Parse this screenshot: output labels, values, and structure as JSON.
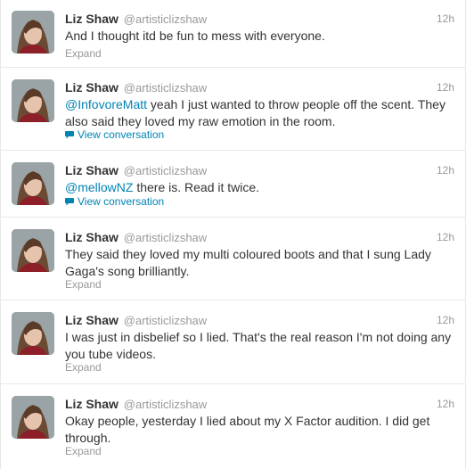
{
  "tweets": [
    {
      "fullname": "Liz Shaw",
      "username": "@artisticlizshaw",
      "time": "12h",
      "mention": "",
      "line1": "And I thought itd be fun to mess with everyone.",
      "line2": "",
      "action": "Expand",
      "action_icon": ""
    },
    {
      "fullname": "Liz Shaw",
      "username": "@artisticlizshaw",
      "time": "12h",
      "mention": "@InfovoreMatt",
      "line1": " yeah I just wanted to throw people off the scent. They",
      "line2": "also said they loved my raw emotion in the room.",
      "action": "View conversation",
      "action_icon": "speech-bubble-icon"
    },
    {
      "fullname": "Liz Shaw",
      "username": "@artisticlizshaw",
      "time": "12h",
      "mention": "@mellowNZ",
      "line1": " there is. Read it twice.",
      "line2": "",
      "action": "View conversation",
      "action_icon": "speech-bubble-icon"
    },
    {
      "fullname": "Liz Shaw",
      "username": "@artisticlizshaw",
      "time": "12h",
      "mention": "",
      "line1": "They said they loved my multi coloured boots and that I sung Lady",
      "line2": "Gaga's song brilliantly.",
      "action": "Expand",
      "action_icon": ""
    },
    {
      "fullname": "Liz Shaw",
      "username": "@artisticlizshaw",
      "time": "12h",
      "mention": "",
      "line1": "I was just in disbelief so I lied. That's the real reason I'm not doing any",
      "line2": "you tube videos.",
      "action": "Expand",
      "action_icon": ""
    },
    {
      "fullname": "Liz Shaw",
      "username": "@artisticlizshaw",
      "time": "12h",
      "mention": "",
      "line1": "Okay people, yesterday I lied about my X Factor audition. I did get",
      "line2": "through.",
      "action": "Expand",
      "action_icon": ""
    }
  ],
  "colors": {
    "link": "#0084b4",
    "secondary_text": "#999999",
    "primary_text": "#333333",
    "divider": "#e8e8e8"
  }
}
